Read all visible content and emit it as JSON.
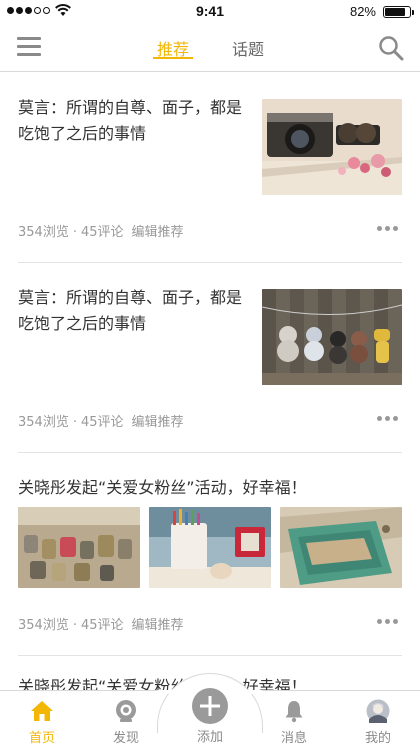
{
  "status_bar": {
    "time": "9:41",
    "battery_percent": "82%",
    "battery_level": 0.82
  },
  "nav": {
    "tabs": [
      {
        "label": "推荐",
        "active": true
      },
      {
        "label": "话题",
        "active": false
      }
    ],
    "menu_icon": "hamburger-menu-icon",
    "search_icon": "search-icon"
  },
  "feed": {
    "items": [
      {
        "title_line1": "莫言：所谓的自尊、面子，都是",
        "title_line2": "吃饱了之后的事情",
        "views": "354浏览",
        "comments": "45评论",
        "tag": "编辑推荐",
        "images": [
          "camera-film-flowers-photo"
        ]
      },
      {
        "title_line1": "莫言：所谓的自尊、面子，都是",
        "title_line2": "吃饱了之后的事情",
        "views": "354浏览",
        "comments": "45评论",
        "tag": "编辑推荐",
        "images": [
          "hanging-plush-toys-photo"
        ]
      },
      {
        "title_line1": "关晓彤发起“关爱女粉丝”活动，好幸福！",
        "views": "354浏览",
        "comments": "45评论",
        "tag": "编辑推荐",
        "images": [
          "love-locks-photo",
          "pencil-cup-hamster-photo",
          "green-vintage-book-photo"
        ]
      },
      {
        "title_line1": "关晓彤发起“关爱女粉丝”活动，好幸福！"
      }
    ],
    "separator": "·"
  },
  "tabbar": {
    "items": [
      {
        "label": "首页",
        "icon": "home-icon",
        "active": true
      },
      {
        "label": "发现",
        "icon": "discover-icon",
        "active": false
      },
      {
        "label": "添加",
        "icon": "add-icon",
        "active": false
      },
      {
        "label": "消息",
        "icon": "bell-icon",
        "active": false
      },
      {
        "label": "我的",
        "icon": "avatar",
        "active": false
      }
    ]
  },
  "colors": {
    "accent": "#f2b705",
    "text": "#333333",
    "muted": "#999999"
  }
}
